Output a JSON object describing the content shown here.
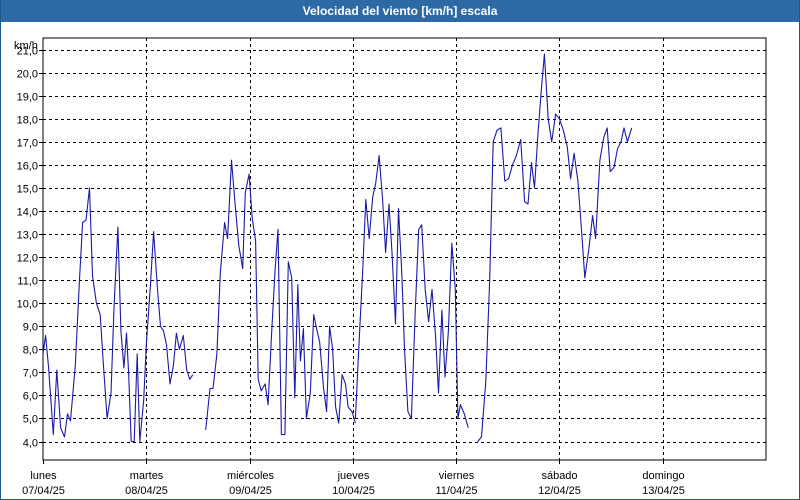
{
  "window": {
    "title": "Velocidad del viento [km/h] escala"
  },
  "chart_data": {
    "type": "line",
    "title": "Velocidad del viento [km/h] escala",
    "ylabel": "km/h",
    "ylim": [
      3.2,
      21.5
    ],
    "yticks": [
      "4,0",
      "5,0",
      "6,0",
      "7,0",
      "8,0",
      "9,0",
      "10,0",
      "11,0",
      "12,0",
      "13,0",
      "14,0",
      "15,0",
      "16,0",
      "17,0",
      "18,0",
      "19,0",
      "20,0",
      "21,0"
    ],
    "xlim": [
      0,
      168
    ],
    "days": [
      {
        "day": "lunes",
        "date": "07/04/25"
      },
      {
        "day": "martes",
        "date": "08/04/25"
      },
      {
        "day": "miércoles",
        "date": "09/04/25"
      },
      {
        "day": "jueves",
        "date": "10/04/25"
      },
      {
        "day": "viernes",
        "date": "11/04/25"
      },
      {
        "day": "sábado",
        "date": "12/04/25"
      },
      {
        "day": "domingo",
        "date": "13/04/25"
      }
    ],
    "grid": true,
    "color": "#1a1aa8",
    "series": [
      {
        "points": [
          [
            0,
            7.8
          ],
          [
            0.6,
            8.6
          ],
          [
            1.3,
            7.2
          ],
          [
            1.9,
            5.6
          ],
          [
            2.4,
            4.3
          ],
          [
            3.2,
            7.1
          ],
          [
            4.1,
            4.6
          ],
          [
            5.0,
            4.2
          ],
          [
            5.7,
            5.2
          ],
          [
            6.4,
            4.9
          ],
          [
            7.5,
            7.3
          ],
          [
            8.5,
            11.1
          ],
          [
            9.2,
            13.5
          ],
          [
            10.0,
            13.6
          ],
          [
            10.8,
            15.0
          ],
          [
            11.5,
            11.2
          ],
          [
            12.4,
            10.0
          ],
          [
            13.3,
            9.5
          ],
          [
            14.0,
            7.4
          ],
          [
            14.9,
            5.0
          ],
          [
            15.8,
            6.1
          ],
          [
            16.5,
            9.8
          ],
          [
            17.4,
            13.3
          ],
          [
            18.1,
            8.8
          ],
          [
            18.8,
            7.2
          ],
          [
            19.4,
            8.7
          ],
          [
            19.9,
            7.0
          ],
          [
            20.5,
            4.0
          ],
          [
            21.2,
            4.0
          ],
          [
            21.9,
            7.8
          ],
          [
            22.5,
            4.0
          ],
          [
            23.4,
            5.8
          ],
          [
            24.0,
            8.2
          ],
          [
            25.0,
            10.9
          ],
          [
            25.7,
            13.1
          ],
          [
            26.6,
            10.6
          ],
          [
            27.3,
            9.0
          ],
          [
            28.0,
            8.8
          ],
          [
            28.7,
            8.2
          ],
          [
            29.5,
            6.5
          ],
          [
            30.3,
            7.3
          ],
          [
            31.0,
            8.7
          ],
          [
            31.7,
            8.0
          ],
          [
            32.6,
            8.6
          ],
          [
            33.4,
            7.1
          ],
          [
            34.1,
            6.7
          ],
          [
            34.8,
            6.9
          ]
        ]
      },
      {
        "points": [
          [
            37.8,
            4.5
          ],
          [
            38.8,
            6.3
          ],
          [
            39.5,
            6.3
          ],
          [
            40.4,
            7.8
          ],
          [
            41.2,
            11.3
          ],
          [
            42.2,
            13.5
          ],
          [
            42.9,
            12.8
          ],
          [
            43.8,
            16.2
          ],
          [
            44.6,
            14.4
          ],
          [
            45.5,
            12.5
          ],
          [
            46.4,
            11.5
          ],
          [
            47.0,
            14.8
          ],
          [
            47.9,
            15.6
          ],
          [
            48.6,
            13.7
          ],
          [
            49.4,
            12.7
          ],
          [
            50.0,
            6.7
          ],
          [
            50.7,
            6.2
          ],
          [
            51.6,
            6.5
          ],
          [
            52.3,
            5.6
          ],
          [
            53.1,
            8.6
          ],
          [
            53.9,
            11.4
          ],
          [
            54.6,
            13.2
          ],
          [
            55.4,
            4.3
          ],
          [
            56.2,
            4.3
          ],
          [
            57.0,
            11.8
          ],
          [
            57.8,
            11.1
          ],
          [
            58.5,
            5.9
          ],
          [
            59.2,
            10.8
          ],
          [
            59.8,
            7.5
          ],
          [
            60.5,
            8.9
          ],
          [
            61.2,
            5.0
          ],
          [
            62.1,
            6.1
          ],
          [
            62.9,
            9.5
          ],
          [
            63.7,
            8.8
          ],
          [
            64.3,
            8.3
          ],
          [
            65.2,
            6.3
          ],
          [
            65.9,
            5.3
          ],
          [
            66.6,
            9.0
          ],
          [
            67.3,
            8.0
          ],
          [
            68.0,
            5.5
          ],
          [
            68.7,
            4.8
          ],
          [
            69.5,
            6.9
          ],
          [
            70.3,
            6.5
          ],
          [
            70.9,
            5.5
          ],
          [
            71.8,
            5.3
          ],
          [
            72.6,
            4.8
          ]
        ]
      },
      {
        "points": [
          [
            72.6,
            5.0
          ],
          [
            73.5,
            8.5
          ],
          [
            74.3,
            11.5
          ],
          [
            75.0,
            14.5
          ],
          [
            75.8,
            12.8
          ],
          [
            76.6,
            14.6
          ],
          [
            77.3,
            15.2
          ],
          [
            78.1,
            16.4
          ],
          [
            78.9,
            14.5
          ],
          [
            79.6,
            12.2
          ],
          [
            80.4,
            14.3
          ],
          [
            81.1,
            12.2
          ],
          [
            81.9,
            9.1
          ],
          [
            82.6,
            14.1
          ],
          [
            83.4,
            11.2
          ],
          [
            84.0,
            8.0
          ],
          [
            84.8,
            5.3
          ],
          [
            85.6,
            5.0
          ],
          [
            86.5,
            9.7
          ],
          [
            87.3,
            13.2
          ],
          [
            88.0,
            13.4
          ],
          [
            88.8,
            10.6
          ],
          [
            89.6,
            9.2
          ],
          [
            90.4,
            10.6
          ],
          [
            91.2,
            8.6
          ],
          [
            91.9,
            6.1
          ],
          [
            92.7,
            9.7
          ],
          [
            93.4,
            6.8
          ],
          [
            94.2,
            8.8
          ],
          [
            95.0,
            12.6
          ],
          [
            95.8,
            10.6
          ],
          [
            96.4,
            5.0
          ],
          [
            97.0,
            5.6
          ],
          [
            97.9,
            5.2
          ],
          [
            98.8,
            4.6
          ]
        ]
      },
      {
        "points": [
          [
            101.0,
            4.0
          ],
          [
            101.9,
            4.2
          ],
          [
            102.9,
            6.6
          ],
          [
            103.8,
            11.0
          ],
          [
            104.6,
            17.0
          ],
          [
            105.5,
            17.5
          ],
          [
            106.4,
            17.6
          ],
          [
            107.3,
            15.3
          ],
          [
            108.2,
            15.4
          ],
          [
            109.1,
            16.0
          ],
          [
            110.0,
            16.4
          ],
          [
            111.0,
            17.1
          ],
          [
            111.9,
            14.4
          ],
          [
            112.7,
            14.3
          ],
          [
            113.5,
            16.1
          ],
          [
            114.2,
            15.0
          ],
          [
            115.0,
            17.3
          ],
          [
            115.8,
            19.3
          ],
          [
            116.5,
            20.8
          ],
          [
            117.4,
            18.0
          ],
          [
            118.2,
            17.0
          ],
          [
            119.1,
            18.2
          ],
          [
            120.0,
            18.0
          ],
          [
            120.9,
            17.5
          ],
          [
            121.8,
            16.8
          ],
          [
            122.6,
            15.4
          ],
          [
            123.4,
            16.5
          ],
          [
            124.3,
            15.3
          ],
          [
            125.2,
            13.0
          ],
          [
            125.9,
            11.1
          ],
          [
            126.8,
            12.3
          ],
          [
            127.7,
            13.8
          ],
          [
            128.4,
            12.8
          ],
          [
            129.4,
            16.2
          ],
          [
            130.3,
            17.2
          ],
          [
            131.1,
            17.6
          ],
          [
            131.8,
            15.7
          ],
          [
            132.7,
            15.9
          ],
          [
            133.5,
            16.7
          ],
          [
            134.3,
            17.0
          ],
          [
            135.0,
            17.6
          ],
          [
            135.8,
            17.0
          ],
          [
            136.8,
            17.6
          ]
        ]
      }
    ]
  }
}
